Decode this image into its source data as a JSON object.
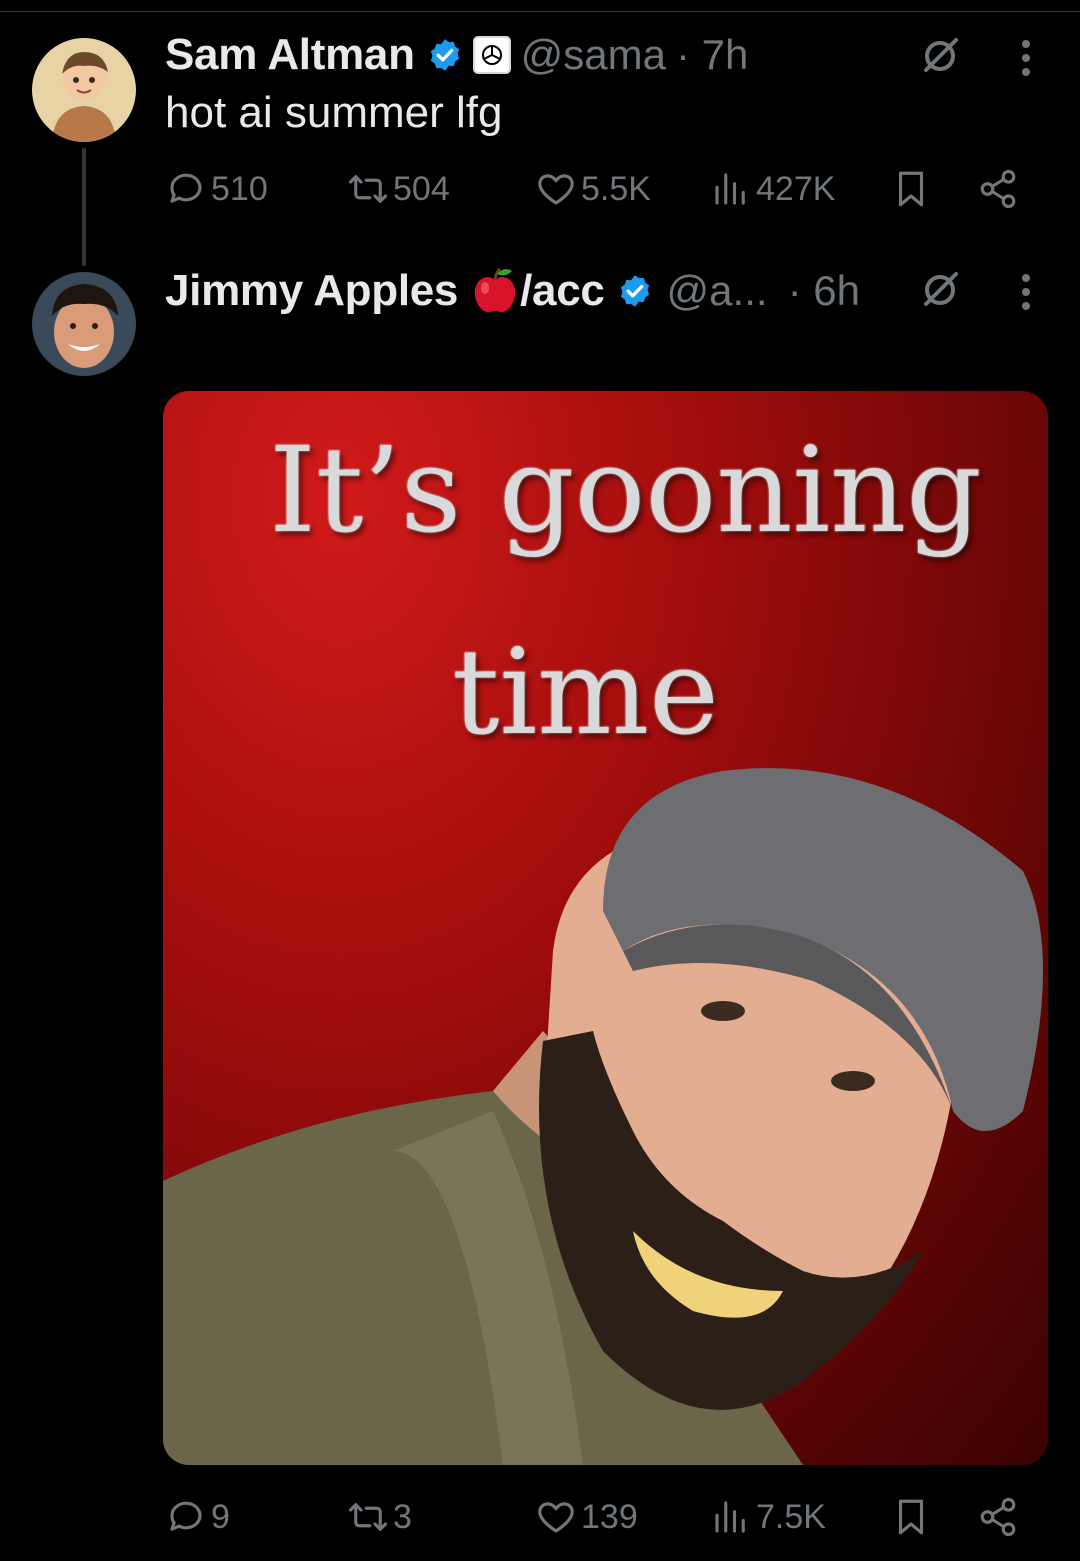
{
  "thread": [
    {
      "author_name": "Sam Altman",
      "handle": "@sama",
      "time": "· 7h",
      "text": "hot ai summer lfg",
      "verified": true,
      "affiliation_icon": "openai-logo-icon",
      "stats": {
        "replies": "510",
        "reposts": "504",
        "likes": "5.5K",
        "views": "427K"
      }
    },
    {
      "author_name": "Jimmy Apples",
      "name_suffix": "/acc",
      "name_emoji": "apple-emoji",
      "handle": "@a...",
      "time": "· 6h",
      "verified": true,
      "media_text": {
        "line1": "It’s gooning",
        "line2": "time"
      },
      "stats": {
        "replies": "9",
        "reposts": "3",
        "likes": "139",
        "views": "7.5K"
      }
    }
  ],
  "colors": {
    "background": "#000000",
    "text": "#e7e9ea",
    "muted": "#71767b",
    "verified": "#1d9bf0",
    "media_red": "#a30d0d"
  },
  "icons": [
    "reply-icon",
    "repost-icon",
    "like-icon",
    "views-icon",
    "bookmark-icon",
    "share-icon",
    "grok-icon",
    "more-icon",
    "verified-badge-icon"
  ]
}
